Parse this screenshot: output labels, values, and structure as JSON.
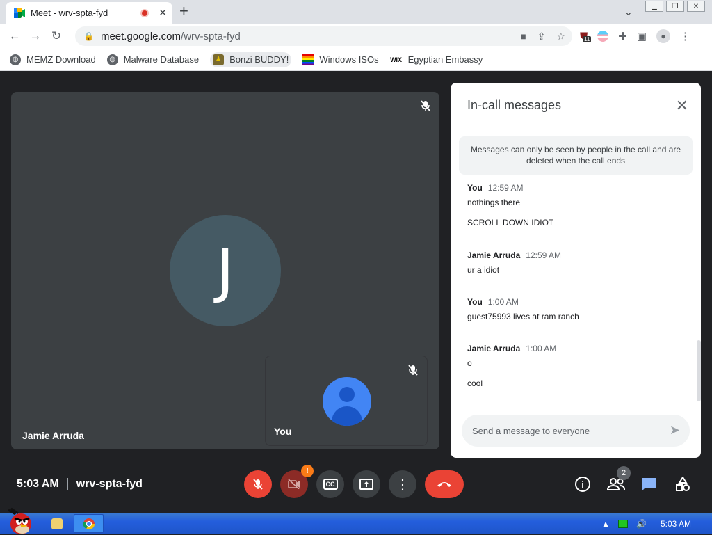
{
  "browser": {
    "tab_title": "Meet - wrv-spta-fyd",
    "new_tab_symbol": "+",
    "url_domain": "meet.google.com",
    "url_path": "/wrv-spta-fyd",
    "extension_badge": "11"
  },
  "bookmarks": [
    {
      "label": "MEMZ Download",
      "icon": "globe-icon"
    },
    {
      "label": "Malware Database",
      "icon": "globe-icon"
    },
    {
      "label": "Bonzi BUDDY!",
      "icon": "bonzi-icon"
    },
    {
      "label": "Windows ISOs",
      "icon": "rainbow-flag-icon"
    },
    {
      "label": "Egyptian Embassy",
      "icon": "wix-icon"
    }
  ],
  "main_tile": {
    "initial": "J",
    "name": "Jamie Arruda"
  },
  "self_tile": {
    "name": "You"
  },
  "chat": {
    "title": "In-call messages",
    "notice": "Messages can only be seen by people in the call and are deleted when the call ends",
    "messages": [
      {
        "sender": "You",
        "time": "12:59 AM",
        "lines": [
          "nothings there",
          "SCROLL DOWN IDIOT"
        ]
      },
      {
        "sender": "Jamie Arruda",
        "time": "12:59 AM",
        "lines": [
          "ur a idiot"
        ]
      },
      {
        "sender": "You",
        "time": "1:00 AM",
        "lines": [
          "guest75993 lives at ram ranch"
        ]
      },
      {
        "sender": "Jamie Arruda",
        "time": "1:00 AM",
        "lines": [
          "o",
          "cool"
        ]
      }
    ],
    "input_placeholder": "Send a message to everyone"
  },
  "meeting": {
    "time": "5:03 AM",
    "code": "wrv-spta-fyd",
    "camera_badge": "!",
    "participant_count": "2"
  },
  "taskbar": {
    "clock": "5:03 AM"
  },
  "colors": {
    "accent_red": "#ea4335",
    "chat_icon_blue": "#8ab4f8",
    "meet_bg": "#202124"
  }
}
